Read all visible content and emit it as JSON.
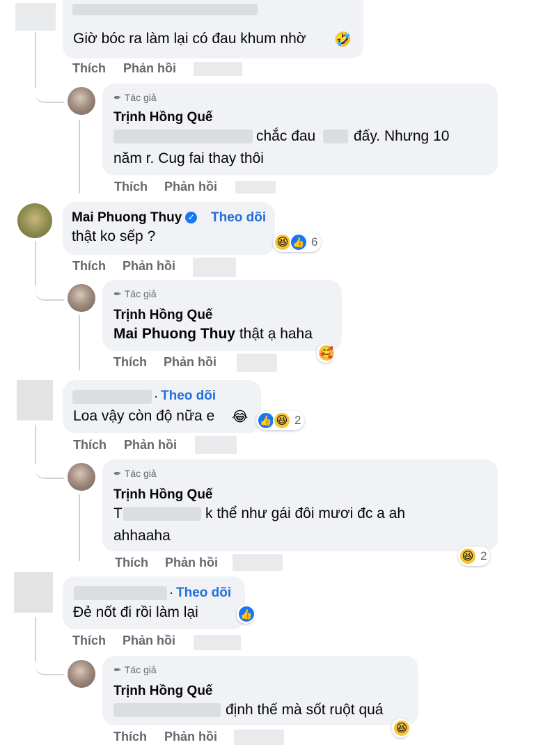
{
  "actions": {
    "like": "Thích",
    "reply": "Phản hồi"
  },
  "follow_label": "Theo dõi",
  "author_badge": "Tác giả",
  "threads": [
    {
      "comment": {
        "text": "Giờ bóc ra làm lại có đau khum nhờ",
        "emoji": "🤣"
      },
      "reply": {
        "name": "Trịnh Hồng Quế",
        "line1": "chắc đau",
        "line1b": "đấy. Nhưng 10",
        "line2": "năm r. Cug fai thay thôi"
      }
    },
    {
      "comment": {
        "name": "Mai Phuong Thuy",
        "text": "thật ko sếp ?",
        "reactions": {
          "icons": [
            "haha-icon",
            "like-icon"
          ],
          "count": "6"
        }
      },
      "reply": {
        "name": "Trịnh Hồng Quế",
        "mention": "Mai Phuong Thuy",
        "text": "thật ạ haha",
        "reactions": {
          "icons": [
            "care-icon"
          ]
        }
      }
    },
    {
      "comment": {
        "text": "Loa vậy còn độ nữa e",
        "emoji": "😂",
        "reactions": {
          "icons": [
            "like-icon",
            "haha-icon"
          ],
          "count": "2"
        }
      },
      "reply": {
        "name": "Trịnh Hồng Quế",
        "line1a": "T",
        "line1": "k thể như gái đôi mươi đc a ah",
        "line2": "ahhaaha",
        "reactions": {
          "icons": [
            "haha-icon"
          ],
          "count": "2"
        }
      }
    },
    {
      "comment": {
        "text": "Đẻ nốt đi rồi làm lại",
        "reactions": {
          "icons": [
            "like-icon"
          ]
        }
      },
      "reply": {
        "name": "Trịnh Hồng Quế",
        "line1": "định thế mà sốt ruột quá",
        "reactions": {
          "icons": [
            "haha-icon"
          ]
        }
      }
    }
  ]
}
